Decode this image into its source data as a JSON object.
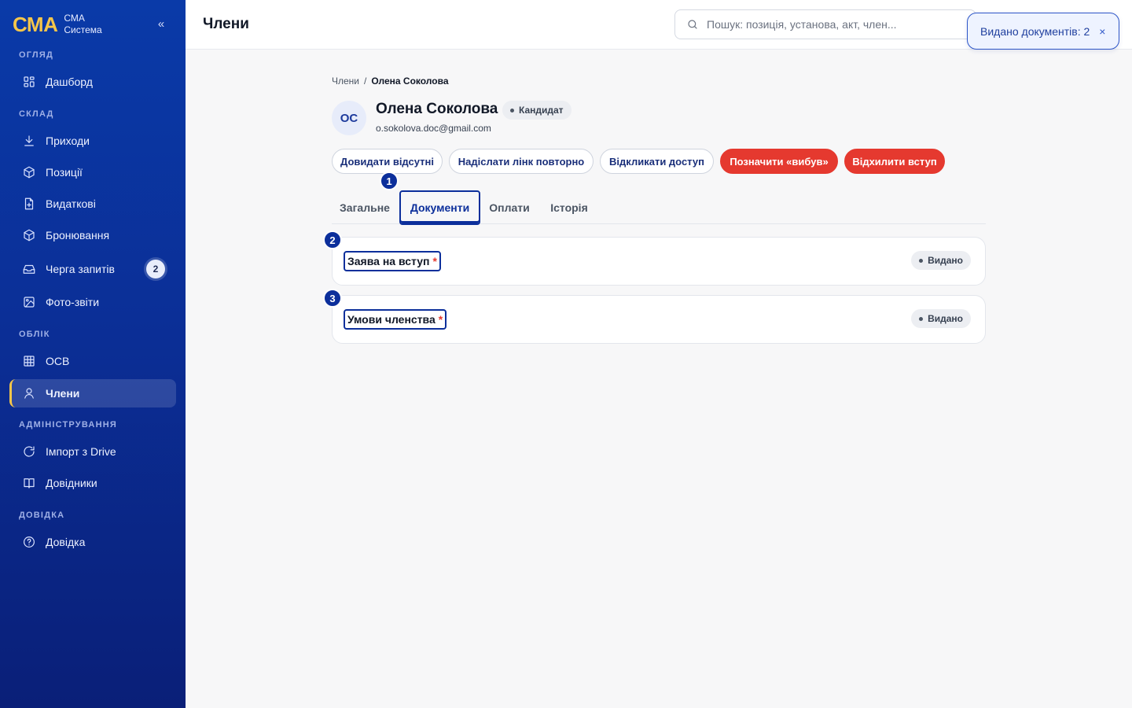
{
  "brand": {
    "logo": "СМА",
    "line1": "СМА",
    "line2": "Система",
    "collapse": "«"
  },
  "sidebar": {
    "sections": [
      {
        "title": "Огляд",
        "items": [
          {
            "label": "Дашборд",
            "icon": "dashboard-icon"
          }
        ]
      },
      {
        "title": "Склад",
        "items": [
          {
            "label": "Приходи",
            "icon": "download-icon"
          },
          {
            "label": "Позиції",
            "icon": "box-icon"
          },
          {
            "label": "Видаткові",
            "icon": "document-icon"
          },
          {
            "label": "Бронювання",
            "icon": "box-icon"
          },
          {
            "label": "Черга запитів",
            "icon": "inbox-icon",
            "badge": "2"
          },
          {
            "label": "Фото-звіти",
            "icon": "image-icon"
          }
        ]
      },
      {
        "title": "Облік",
        "items": [
          {
            "label": "ОСВ",
            "icon": "table-icon"
          },
          {
            "label": "Члени",
            "icon": "user-icon",
            "active": true
          }
        ]
      },
      {
        "title": "Адміністрування",
        "items": [
          {
            "label": "Імпорт з Drive",
            "icon": "refresh-icon"
          },
          {
            "label": "Довідники",
            "icon": "book-icon"
          }
        ]
      },
      {
        "title": "Довідка",
        "items": [
          {
            "label": "Довідка",
            "icon": "help-icon"
          }
        ]
      }
    ]
  },
  "header": {
    "title": "Члени",
    "search_placeholder": "Пошук: позиція, установа, акт, член..."
  },
  "toast": {
    "text": "Видано документів: 2",
    "close": "×"
  },
  "breadcrumb": {
    "parent": "Члени",
    "separator": "/",
    "current": "Олена Соколова"
  },
  "member": {
    "initials": "ОС",
    "name": "Олена Соколова",
    "status": "Кандидат",
    "email": "o.sokolova.doc@gmail.com"
  },
  "actions": [
    {
      "label": "Довидати відсутні",
      "variant": "outline"
    },
    {
      "label": "Надіслати лінк повторно",
      "variant": "outline"
    },
    {
      "label": "Відкликати доступ",
      "variant": "outline"
    },
    {
      "label": "Позначити «вибув»",
      "variant": "danger"
    },
    {
      "label": "Відхилити вступ",
      "variant": "danger"
    }
  ],
  "tabs": [
    {
      "label": "Загальне"
    },
    {
      "label": "Документи",
      "active": true
    },
    {
      "label": "Оплати"
    },
    {
      "label": "Історія"
    }
  ],
  "documents": [
    {
      "title": "Заява на вступ",
      "required": "*",
      "status": "Видано"
    },
    {
      "title": "Умови членства",
      "required": "*",
      "status": "Видано"
    }
  ],
  "markers": [
    "1",
    "2",
    "3"
  ],
  "colors": {
    "primary": "#0c2f9b",
    "danger": "#e5392f",
    "accent": "#f5c64a",
    "sidebar_bg": "#0b2f97"
  }
}
